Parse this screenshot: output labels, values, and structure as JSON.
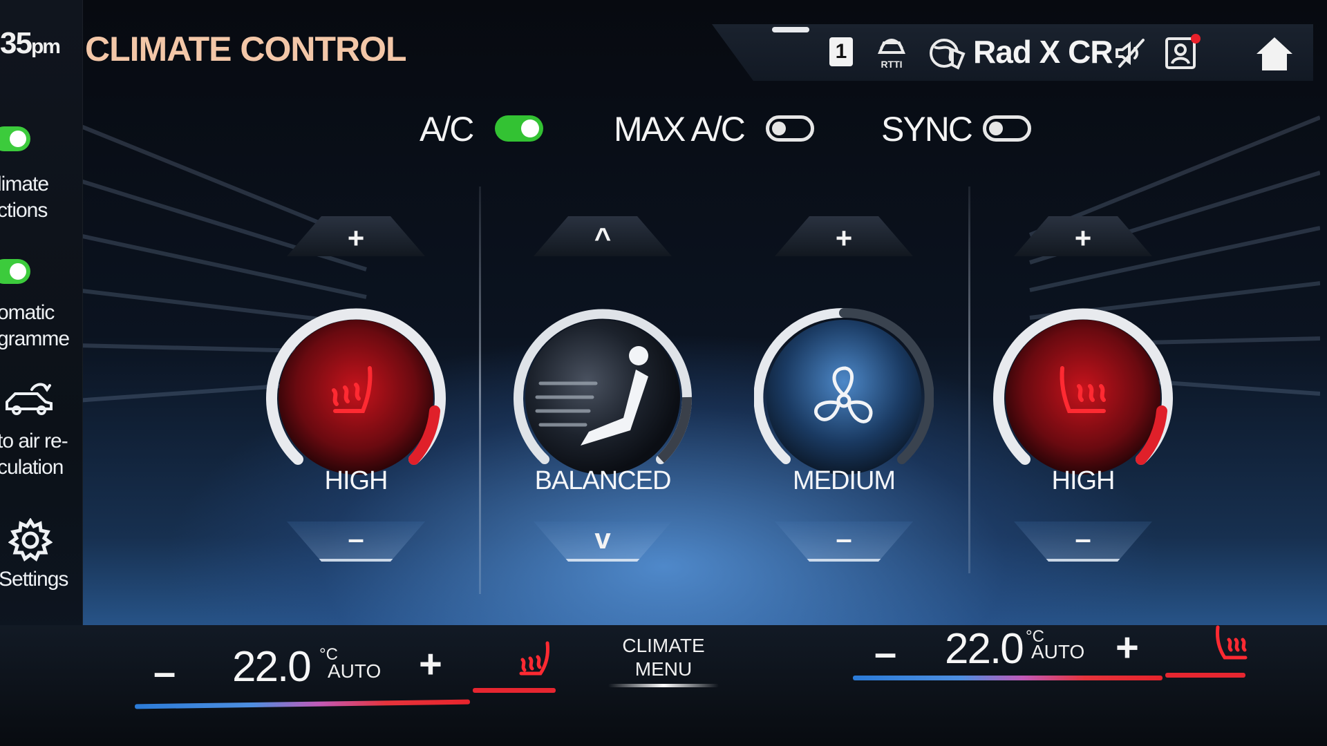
{
  "header": {
    "clock_main": "35",
    "clock_suffix": "pm",
    "title": "CLIMATE CONTROL",
    "status": {
      "channel_badge": "1",
      "rtti_label": "RTTI",
      "station": "Rad X CR",
      "icons": [
        "rtti-icon",
        "navigation-globe-icon",
        "mute-icon",
        "profile-icon",
        "home-icon"
      ],
      "notification_dot_color": "#e8202a"
    }
  },
  "sidebar": {
    "items": [
      {
        "label": "limate\nctions",
        "toggle": true
      },
      {
        "label": "omatic\ngramme",
        "toggle": true
      },
      {
        "label": "to air re-\nculation",
        "icon": "car-recirculation-icon"
      },
      {
        "label": "Settings",
        "icon": "gear-icon"
      }
    ]
  },
  "toggles": [
    {
      "label": "A/C",
      "on": true
    },
    {
      "label": "MAX A/C",
      "on": false
    },
    {
      "label": "SYNC",
      "on": false
    }
  ],
  "controls": [
    {
      "id": "driver-seat-heating",
      "icon": "seat-heating-icon",
      "up": "+",
      "down": "–",
      "level_label": "HIGH",
      "level": 1.0,
      "theme": "red"
    },
    {
      "id": "air-distribution",
      "icon": "seat-airflow-icon",
      "up": "^",
      "down": "v",
      "level_label": "BALANCED",
      "level": 0.5,
      "theme": "dark"
    },
    {
      "id": "fan-speed",
      "icon": "fan-icon",
      "up": "+",
      "down": "–",
      "level_label": "MEDIUM",
      "level": 0.5,
      "theme": "blue"
    },
    {
      "id": "passenger-seat-heating",
      "icon": "seat-heating-icon",
      "up": "+",
      "down": "–",
      "level_label": "HIGH",
      "level": 1.0,
      "theme": "red"
    }
  ],
  "bottom": {
    "driver": {
      "minus": "–",
      "value": "22.0",
      "unit": "°C",
      "mode": "AUTO",
      "plus": "+"
    },
    "climate_menu": "CLIMATE\nMENU",
    "passenger": {
      "minus": "–",
      "value": "22.0",
      "unit": "°C",
      "mode": "AUTO",
      "plus": "+"
    }
  },
  "colors": {
    "accent_title": "#f3c7a8",
    "toggle_on": "#33c233",
    "heat_red": "#e62630",
    "cool_blue": "#2b7bd8"
  }
}
